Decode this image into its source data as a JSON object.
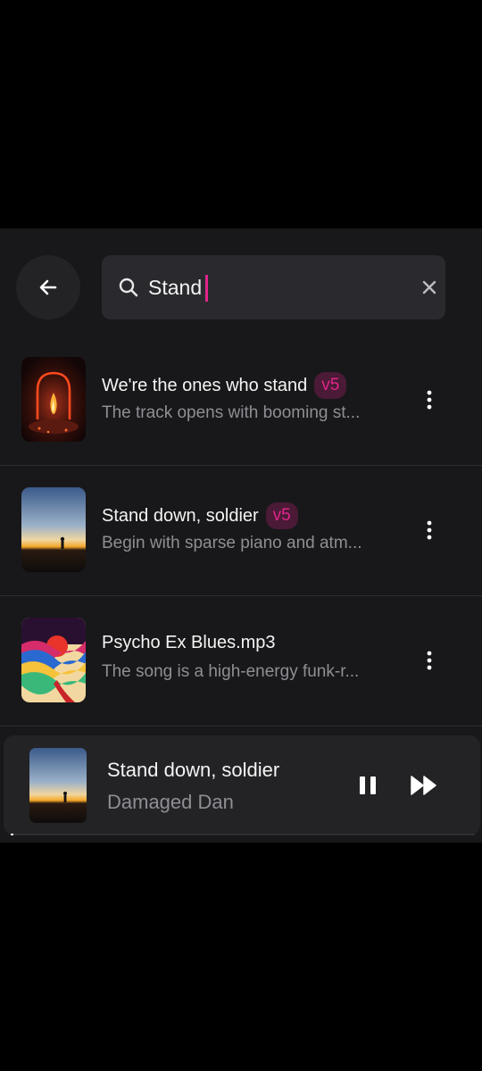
{
  "search": {
    "value": "Stand",
    "placeholder": ""
  },
  "results": [
    {
      "title": "We're the ones who stand",
      "version": "v5",
      "description": "The track opens with booming st...",
      "cover": "fire-arch"
    },
    {
      "title": "Stand down, soldier",
      "version": "v5",
      "description": "Begin with sparse piano and atm...",
      "cover": "sunset-silhouette"
    },
    {
      "title": "Psycho Ex Blues.mp3",
      "version": "",
      "description": "The song is a high-energy funk-r...",
      "cover": "psychedelic-waves"
    }
  ],
  "now_playing": {
    "title": "Stand down, soldier",
    "artist": "Damaged Dan",
    "progress": 0.0,
    "cover": "sunset-silhouette"
  },
  "colors": {
    "accent": "#e0258a",
    "badge_bg": "#4a1a36",
    "surface": "#18181a",
    "card": "#232326",
    "muted_text": "#8e8e94"
  },
  "icons": {
    "back": "arrow-left-icon",
    "search": "search-icon",
    "clear": "close-icon",
    "more": "more-vertical-icon",
    "pause": "pause-icon",
    "skip": "fast-forward-icon"
  }
}
